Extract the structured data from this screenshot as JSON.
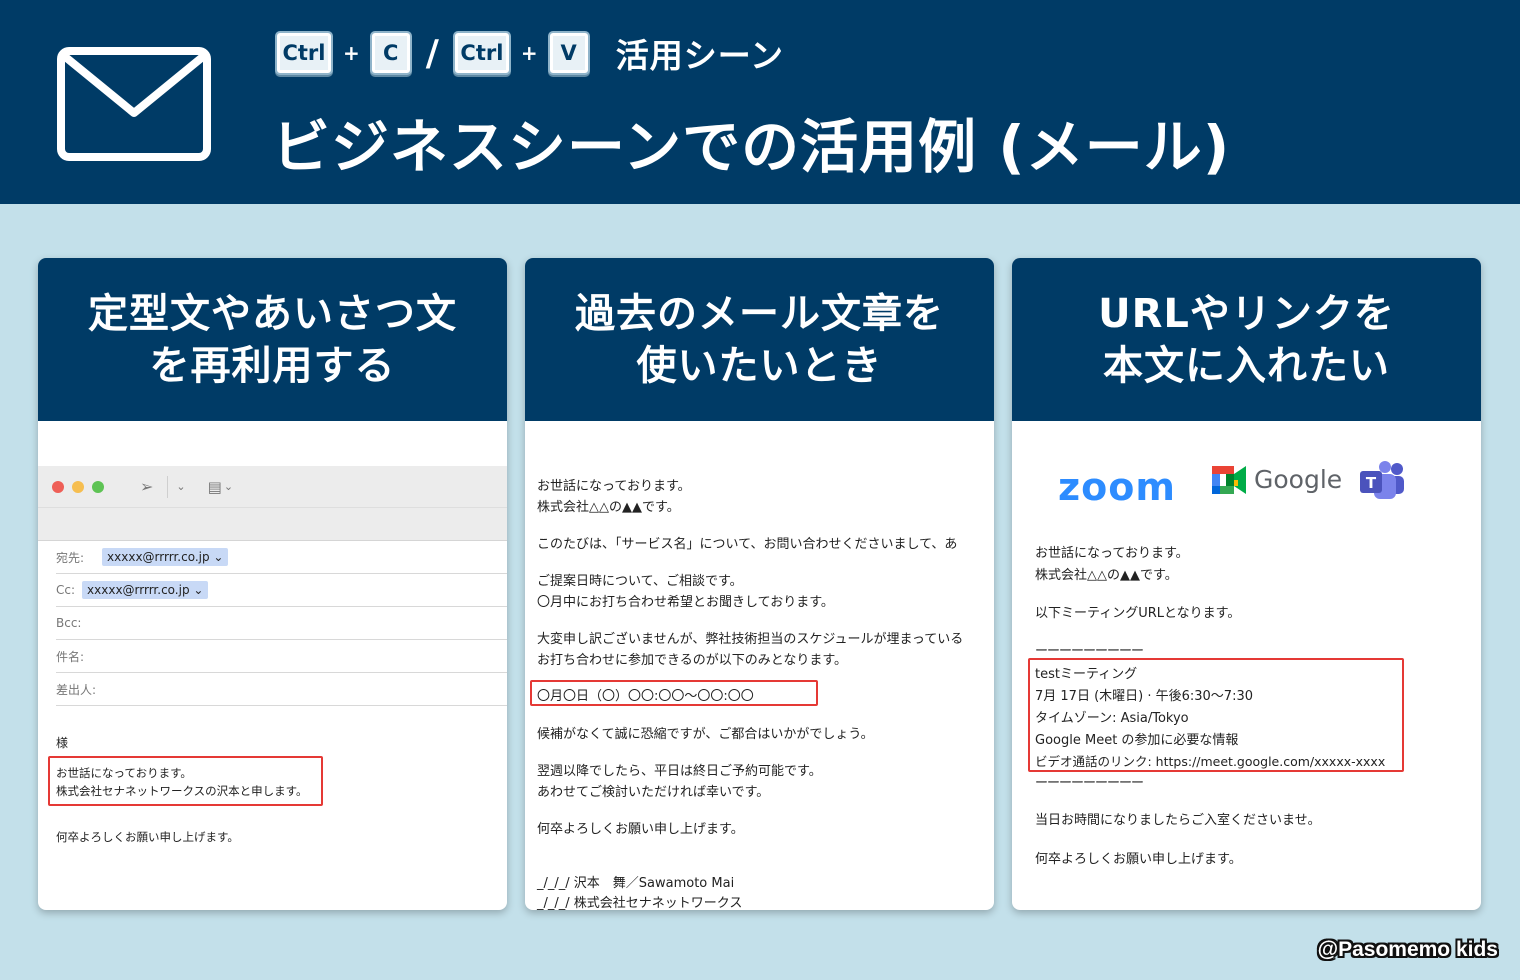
{
  "header": {
    "keys": {
      "ctrl": "Ctrl",
      "copy": "C",
      "paste": "V",
      "plus": "+",
      "slash": "/"
    },
    "subtitle": "活用シーン",
    "title": "ビジネスシーンでの活用例 (メール)",
    "bg_color": "#003b66"
  },
  "cards": [
    {
      "title_lines": [
        "定型文やあいさつ文",
        "を再利用する"
      ],
      "mail": {
        "to_label": "宛先:",
        "to_value": "xxxxx@rrrrr.co.jp",
        "cc_label": "Cc:",
        "cc_value": "xxxxx@rrrrr.co.jp",
        "bcc_label": "Bcc:",
        "subject_label": "件名:",
        "from_label": "差出人:",
        "salutation": "様",
        "boxed_lines": [
          "お世話になっております。",
          "株式会社セナネットワークスの沢本と申します。"
        ],
        "closing": "何卒よろしくお願い申し上げます。"
      }
    },
    {
      "title_lines": [
        "過去のメール文章を",
        "使いたいとき"
      ],
      "lines": [
        "お世話になっております。",
        "株式会社△△の▲▲です。",
        "このたびは、「サービス名」について、お問い合わせくださいまして、あ",
        "ご提案日時について、ご相談です。",
        "〇月中にお打ち合わせ希望とお聞きしております。",
        "大変申し訳ございませんが、弊社技術担当のスケジュールが埋まっている",
        "お打ち合わせに参加できるのが以下のみとなります。",
        "〇月〇日（〇）〇〇:〇〇〜〇〇:〇〇",
        "候補がなくて誠に恐縮ですが、ご都合はいかがでしょう。",
        "翌週以降でしたら、平日は終日ご予約可能です。",
        "あわせてご検討いただければ幸いです。",
        "何卒よろしくお願い申し上げます。",
        "_/_/_/ 沢本　舞／Sawamoto Mai",
        "_/_/_/ 株式会社セナネットワークス"
      ]
    },
    {
      "title_lines": [
        "URLやリンクを",
        "本文に入れたい"
      ],
      "logos": {
        "zoom": "zoom",
        "google": "Google",
        "teams_letter": "T"
      },
      "lines": [
        "お世話になっております。",
        "株式会社△△の▲▲です。",
        "以下ミーティングURLとなります。",
        "ーーーーーーーーー",
        "testミーティング",
        "7月 17日 (木曜日) · 午後6:30〜7:30",
        "タイムゾーン: Asia/Tokyo",
        "Google Meet の参加に必要な情報",
        "ビデオ通話のリンク: https://meet.google.com/xxxxx-xxxx",
        "ーーーーーーーーー",
        "当日お時間になりましたらご入室くださいませ。",
        "何卒よろしくお願い申し上げます。"
      ]
    }
  ],
  "credit": "@Pasomemo kids",
  "colors": {
    "navy": "#003b66",
    "background": "#c3e0ea",
    "highlight_red": "#e53935",
    "chip_blue": "#c8d9f6"
  }
}
